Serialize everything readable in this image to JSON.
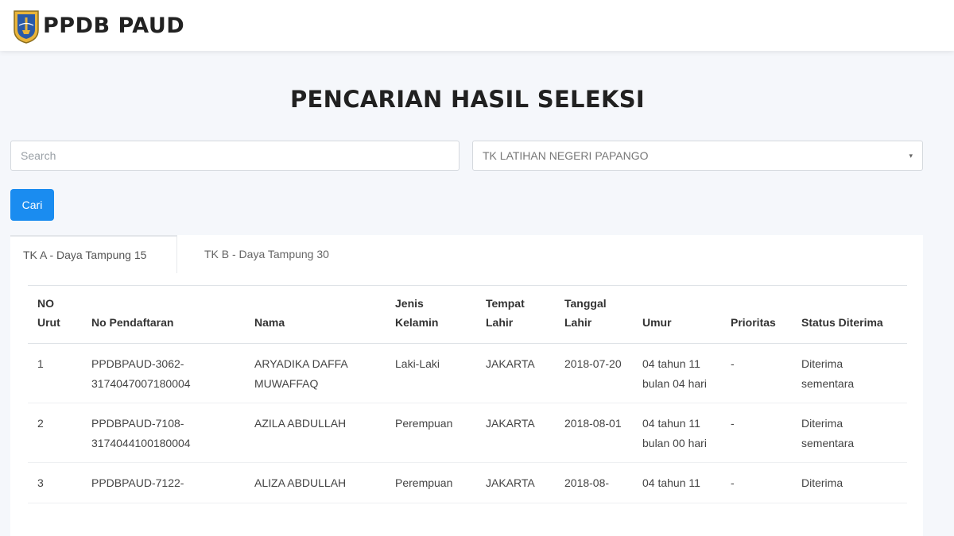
{
  "header": {
    "brand": "PPDB PAUD"
  },
  "page": {
    "title": "PENCARIAN HASIL SELEKSI"
  },
  "search": {
    "placeholder": "Search",
    "value": ""
  },
  "school_select": {
    "selected": "TK LATIHAN NEGERI PAPANGO"
  },
  "buttons": {
    "search_label": "Cari"
  },
  "tabs": [
    {
      "label": "TK A - Daya Tampung 15",
      "active": true
    },
    {
      "label": "TK B - Daya Tampung 30",
      "active": false
    }
  ],
  "table": {
    "headers": [
      "NO Urut",
      "No Pendaftaran",
      "Nama",
      "Jenis Kelamin",
      "Tempat Lahir",
      "Tanggal Lahir",
      "Umur",
      "Prioritas",
      "Status Diterima"
    ],
    "rows": [
      [
        "1",
        "PPDBPAUD-3062-3174047007180004",
        "ARYADIKA DAFFA MUWAFFAQ",
        "Laki-Laki",
        "JAKARTA",
        "2018-07-20",
        "04 tahun 11 bulan 04 hari",
        "-",
        "Diterima sementara"
      ],
      [
        "2",
        "PPDBPAUD-7108-3174044100180004",
        "AZILA ABDULLAH",
        "Perempuan",
        "JAKARTA",
        "2018-08-01",
        "04 tahun 11 bulan 00 hari",
        "-",
        "Diterima sementara"
      ],
      [
        "3",
        "PPDBPAUD-7122-",
        "ALIZA ABDULLAH",
        "Perempuan",
        "JAKARTA",
        "2018-08-",
        "04 tahun 11",
        "-",
        "Diterima"
      ]
    ]
  },
  "colors": {
    "primary": "#1a8cf0",
    "status_accepted": "#2e8b57",
    "background": "#f5f7fb"
  }
}
